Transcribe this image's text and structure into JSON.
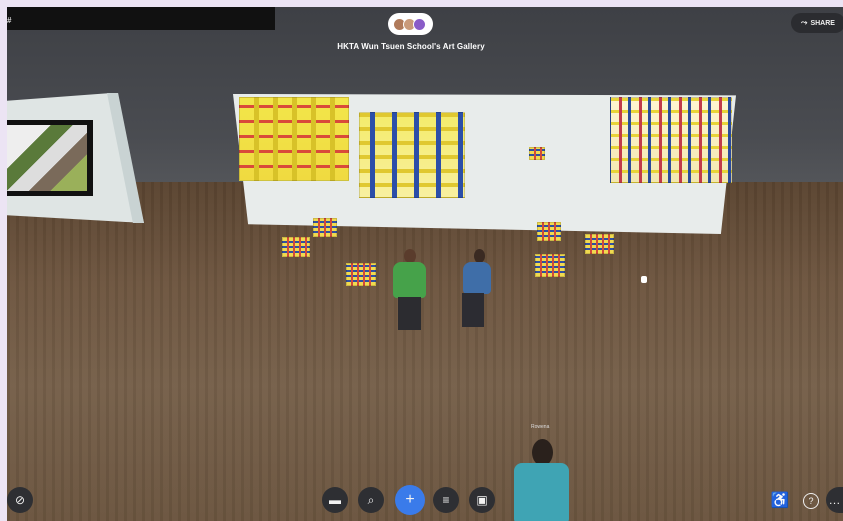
{
  "header": {
    "title": "HKTA Wun Tsuen School's Art Gallery",
    "share_label": "SHARE",
    "left_badge": "#"
  },
  "local_avatar": {
    "name_tag": "Rowena"
  },
  "toolbar": {
    "items": [
      {
        "name": "file",
        "glyph": "▬"
      },
      {
        "name": "search",
        "glyph": "⌕"
      },
      {
        "name": "add",
        "glyph": "+"
      },
      {
        "name": "filter",
        "glyph": "≡"
      },
      {
        "name": "image",
        "glyph": "▣"
      }
    ]
  },
  "right_controls": {
    "accessibility_glyph": "♿",
    "help_glyph": "?",
    "more_glyph": "…"
  },
  "left_control_glyph": "⊘",
  "colors": {
    "accent": "#3a7bea",
    "hud_bg": "#2e2f33"
  }
}
